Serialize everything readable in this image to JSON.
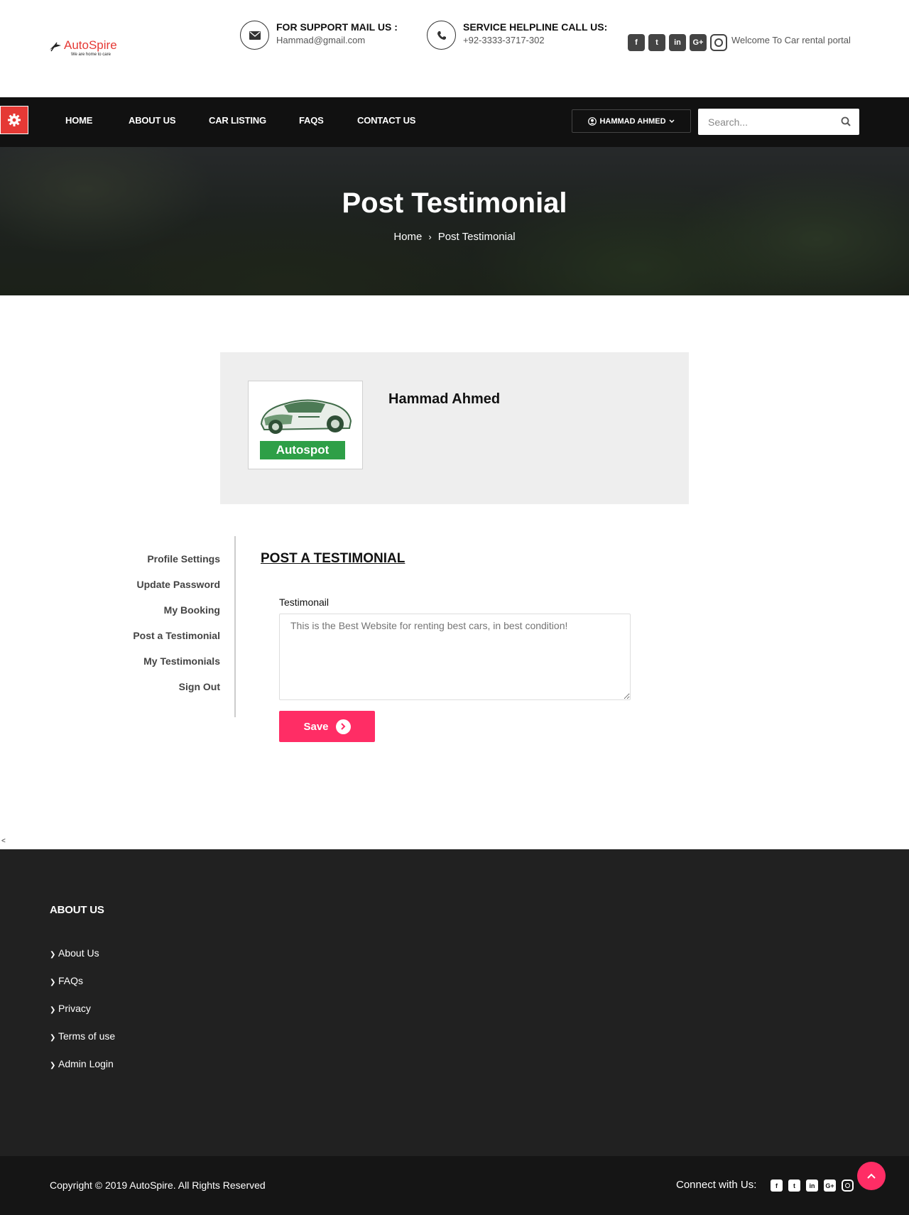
{
  "logo": {
    "name": "AutoSpire",
    "tagline": "We are home to care"
  },
  "header": {
    "support_label": "FOR SUPPORT MAIL US :",
    "support_email": "Hammad@gmail.com",
    "helpline_label": "SERVICE HELPLINE CALL US:",
    "helpline_phone": "+92-3333-3717-302",
    "welcome": "Welcome To Car rental portal",
    "social": [
      "facebook-icon",
      "twitter-icon",
      "linkedin-icon",
      "google-plus-icon",
      "instagram-icon"
    ]
  },
  "nav": {
    "items": [
      "HOME",
      "ABOUT US",
      "CAR LISTING",
      "FAQS",
      "CONTACT US"
    ],
    "user": "HAMMAD AHMED",
    "search_placeholder": "Search..."
  },
  "banner": {
    "title": "Post Testimonial",
    "breadcrumb": [
      "Home",
      "Post Testimonial"
    ]
  },
  "profile": {
    "name": "Hammad Ahmed",
    "avatar_badge": "Autospot"
  },
  "side_menu": [
    "Profile Settings",
    "Update Password",
    "My Booking",
    "Post a Testimonial",
    "My Testimonials",
    "Sign Out"
  ],
  "form": {
    "title": "POST A TESTIMONIAL",
    "label": "Testimonail",
    "placeholder": "This is the Best Website for renting best cars, in best condition!",
    "save": "Save"
  },
  "stray_char": "<",
  "footer": {
    "heading": "ABOUT US",
    "links": [
      "About Us",
      "FAQs",
      "Privacy",
      "Terms of use",
      "Admin Login"
    ],
    "copyright": "Copyright © 2019 AutoSpire. All Rights Reserved",
    "connect": "Connect with Us:"
  },
  "colors": {
    "accent_red": "#e53935",
    "accent_pink": "#ff2d65",
    "badge_green": "#2e9f47",
    "footer_bg": "#212121"
  }
}
